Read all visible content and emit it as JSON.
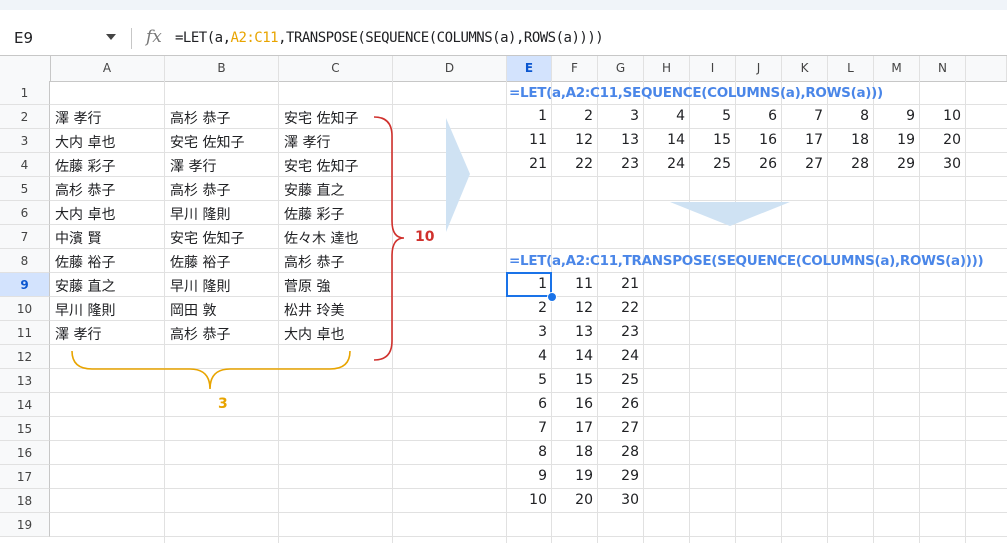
{
  "name_box": "E9",
  "formula_bar": {
    "prefix": "=LET(a,",
    "ref": "A2:C11",
    "suffix": ",TRANSPOSE(SEQUENCE(COLUMNS(a),ROWS(a))))"
  },
  "columns": [
    "A",
    "B",
    "C",
    "D",
    "E",
    "F",
    "G",
    "H",
    "I",
    "J",
    "K",
    "L",
    "M",
    "N"
  ],
  "rows": [
    "1",
    "2",
    "3",
    "4",
    "5",
    "6",
    "7",
    "8",
    "9",
    "10",
    "11",
    "12",
    "13",
    "14",
    "15",
    "16",
    "17",
    "18",
    "19"
  ],
  "active_col": "E",
  "active_row": "9",
  "names_table": [
    [
      "澤 孝行",
      "高杉 恭子",
      "安宅 佐知子"
    ],
    [
      "大内 卓也",
      "安宅 佐知子",
      "澤 孝行"
    ],
    [
      "佐藤 彩子",
      "澤 孝行",
      "安宅 佐知子"
    ],
    [
      "高杉 恭子",
      "高杉 恭子",
      "安藤 直之"
    ],
    [
      "大内 卓也",
      "早川 隆則",
      "佐藤 彩子"
    ],
    [
      "中濱 賢",
      "安宅 佐知子",
      "佐々木 達也"
    ],
    [
      "佐藤 裕子",
      "佐藤 裕子",
      "高杉 恭子"
    ],
    [
      "安藤 直之",
      "早川 隆則",
      "菅原 強"
    ],
    [
      "早川 隆則",
      "岡田 敦",
      "松井 玲美"
    ],
    [
      "澤 孝行",
      "高杉 恭子",
      "大内 卓也"
    ]
  ],
  "formula1_label": "=LET(a,A2:C11,SEQUENCE(COLUMNS(a),ROWS(a)))",
  "sequence_result": [
    [
      "1",
      "2",
      "3",
      "4",
      "5",
      "6",
      "7",
      "8",
      "9",
      "10"
    ],
    [
      "11",
      "12",
      "13",
      "14",
      "15",
      "16",
      "17",
      "18",
      "19",
      "20"
    ],
    [
      "21",
      "22",
      "23",
      "24",
      "25",
      "26",
      "27",
      "28",
      "29",
      "30"
    ]
  ],
  "formula2_label": "=LET(a,A2:C11,TRANSPOSE(SEQUENCE(COLUMNS(a),ROWS(a))))",
  "transpose_result": [
    [
      "1",
      "11",
      "21"
    ],
    [
      "2",
      "12",
      "22"
    ],
    [
      "3",
      "13",
      "23"
    ],
    [
      "4",
      "14",
      "24"
    ],
    [
      "5",
      "15",
      "25"
    ],
    [
      "6",
      "16",
      "26"
    ],
    [
      "7",
      "17",
      "27"
    ],
    [
      "8",
      "18",
      "28"
    ],
    [
      "9",
      "19",
      "29"
    ],
    [
      "10",
      "20",
      "30"
    ]
  ],
  "annotations": {
    "rows_count": "10",
    "cols_count": "3",
    "rows_color": "#d0312d",
    "cols_color": "#e8a400"
  },
  "arrow_color": "#cfe2f3"
}
